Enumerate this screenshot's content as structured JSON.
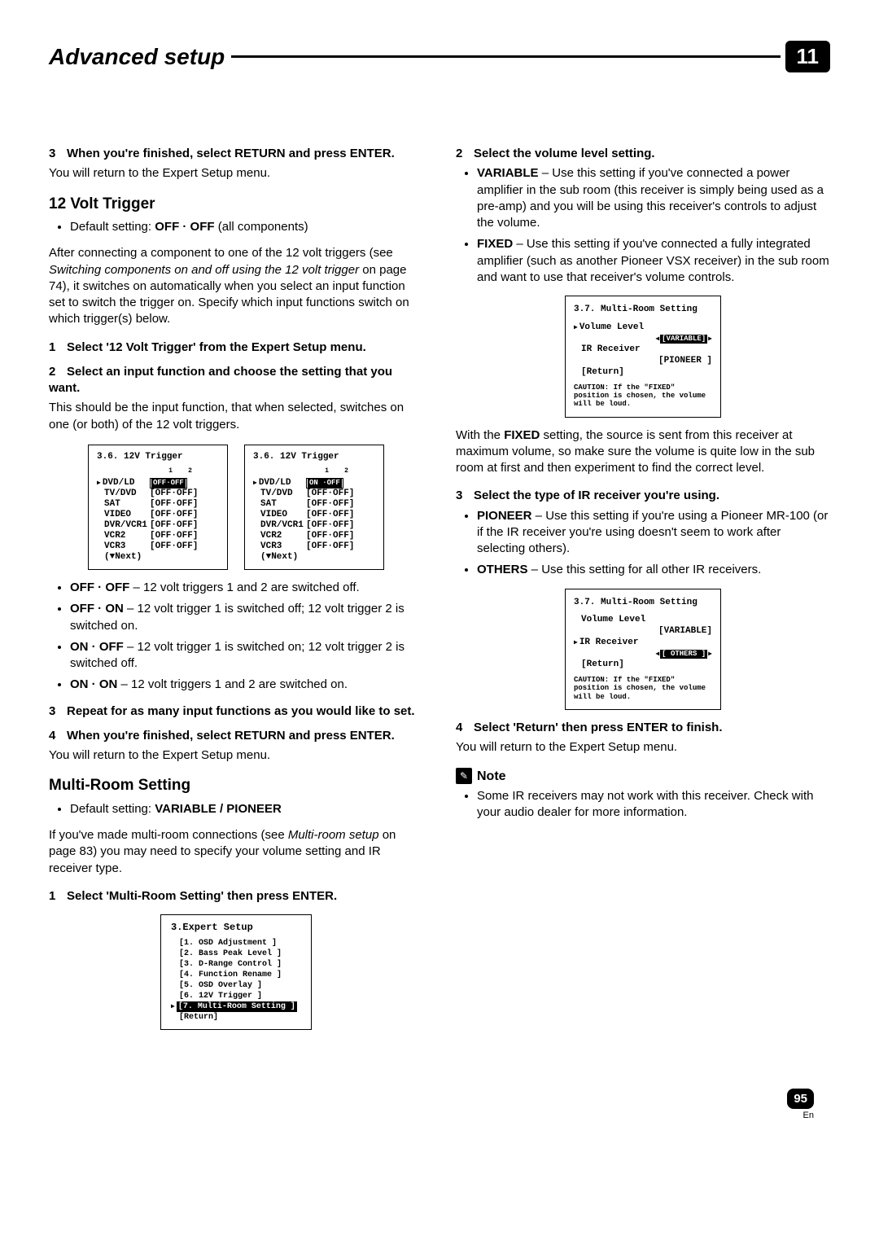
{
  "header": {
    "title": "Advanced setup",
    "chapter": "11"
  },
  "left": {
    "step3a_heading": "When you're finished, select RETURN and press ENTER.",
    "step3a_body": "You will return to the Expert Setup menu.",
    "sec_12v_title": "12 Volt Trigger",
    "sec_12v_default_prefix": "Default setting: ",
    "sec_12v_default_value": "OFF · OFF",
    "sec_12v_default_suffix": " (all components)",
    "sec_12v_intro_a": "After connecting a component to one of the 12 volt triggers (see ",
    "sec_12v_intro_italic": "Switching components on and off using the 12 volt trigger",
    "sec_12v_intro_b": " on page 74), it switches on automatically when you select an input function set to switch the trigger on. Specify which input functions switch on which trigger(s) below.",
    "sec_12v_step1": "Select '12 Volt Trigger' from the Expert Setup menu.",
    "sec_12v_step2": "Select an input function and choose the setting that you want.",
    "sec_12v_step2_body": "This should be the input function, that when selected, switches on one (or both) of the 12 volt triggers.",
    "osd12v_title": "3.6. 12V Trigger",
    "osd12v_labels": [
      "DVD/LD",
      "TV/DVD",
      "SAT",
      "VIDEO",
      "DVR/VCR1",
      "VCR2",
      "VCR3",
      "(▼Next)"
    ],
    "osd12v_left_sel": "OFF·OFF",
    "osd12v_right_sel": "ON ·OFF",
    "osd12v_value": "[OFF·OFF]",
    "sec_12v_offoff_label": "OFF · OFF",
    "sec_12v_offoff_text": " – 12 volt triggers 1 and 2 are switched off.",
    "sec_12v_offon_label": "OFF · ON",
    "sec_12v_offon_text": " – 12 volt trigger 1 is switched off; 12 volt trigger 2 is switched on.",
    "sec_12v_onoff_label": "ON · OFF",
    "sec_12v_onoff_text": " – 12 volt trigger 1 is switched on; 12 volt trigger 2 is switched off.",
    "sec_12v_onon_label": "ON · ON",
    "sec_12v_onon_text": " – 12 volt triggers 1 and 2 are switched on.",
    "sec_12v_step3": "Repeat for as many input functions as you would like to set.",
    "sec_12v_step4": "When you're finished, select RETURN and press ENTER.",
    "sec_12v_step4_body": "You will return to the Expert Setup menu.",
    "sec_mr_title": "Multi-Room Setting",
    "sec_mr_default_prefix": "Default setting: ",
    "sec_mr_default_value": "VARIABLE / PIONEER",
    "sec_mr_intro_a": "If you've made multi-room connections (see ",
    "sec_mr_intro_italic": "Multi-room setup",
    "sec_mr_intro_b": " on page 83) you may need to specify your volume setting and IR receiver type.",
    "sec_mr_step1": "Select 'Multi-Room Setting' then press ENTER.",
    "expert_menu_title": "3.Expert Setup",
    "expert_menu_items": [
      "[1. OSD Adjustment ]",
      "[2. Bass Peak Level ]",
      "[3. D-Range Control ]",
      "[4. Function Rename ]",
      "[5. OSD Overlay ]",
      "[6. 12V Trigger ]"
    ],
    "expert_menu_selected": "[7. Multi-Room Setting ]",
    "expert_menu_return": "[Return]"
  },
  "right": {
    "step2_heading": "Select the volume level setting.",
    "variable_label": "VARIABLE",
    "variable_text": " – Use this setting if you've connected a power amplifier in the sub room (this receiver is simply being used as a pre-amp) and you will be using this receiver's controls to adjust the volume.",
    "fixed_label": "FIXED",
    "fixed_text": " – Use this setting if you've connected a fully integrated amplifier (such as another Pioneer VSX receiver) in the sub room and want to use that receiver's volume controls.",
    "osd_mr_title": "3.7. Multi-Room Setting",
    "osd_mr_vol_label": "Volume Level",
    "osd_mr_vol_value_variable": "[VARIABLE]",
    "osd_mr_vol_value_variable_plain": "[VARIABLE]",
    "osd_mr_ir_label": "IR Receiver",
    "osd_mr_ir_value_pioneer": "[PIONEER ]",
    "osd_mr_ir_value_others": "[ OTHERS ]",
    "osd_mr_return": "[Return]",
    "osd_mr_caution": "CAUTION: If the \"FIXED\" position is chosen, the volume will be loud.",
    "fixed_para_a": "With the ",
    "fixed_para_b": " setting, the source is sent from this receiver at maximum volume, so make sure the volume is quite low in the sub room at first and then experiment to find the correct level.",
    "step3_heading": "Select the type of IR receiver you're using.",
    "pioneer_label": "PIONEER",
    "pioneer_text": " – Use this setting if you're using a Pioneer MR-100 (or if the IR receiver you're using doesn't seem to work after selecting others).",
    "others_label": "OTHERS",
    "others_text": " – Use this setting for all other IR receivers.",
    "step4_heading": "Select 'Return' then press ENTER to finish.",
    "step4_body": "You will return to the Expert Setup menu.",
    "note_label": "Note",
    "note_text": "Some IR receivers may not work with this receiver. Check with your audio dealer for more information."
  },
  "footer": {
    "page": "95",
    "lang": "En"
  }
}
